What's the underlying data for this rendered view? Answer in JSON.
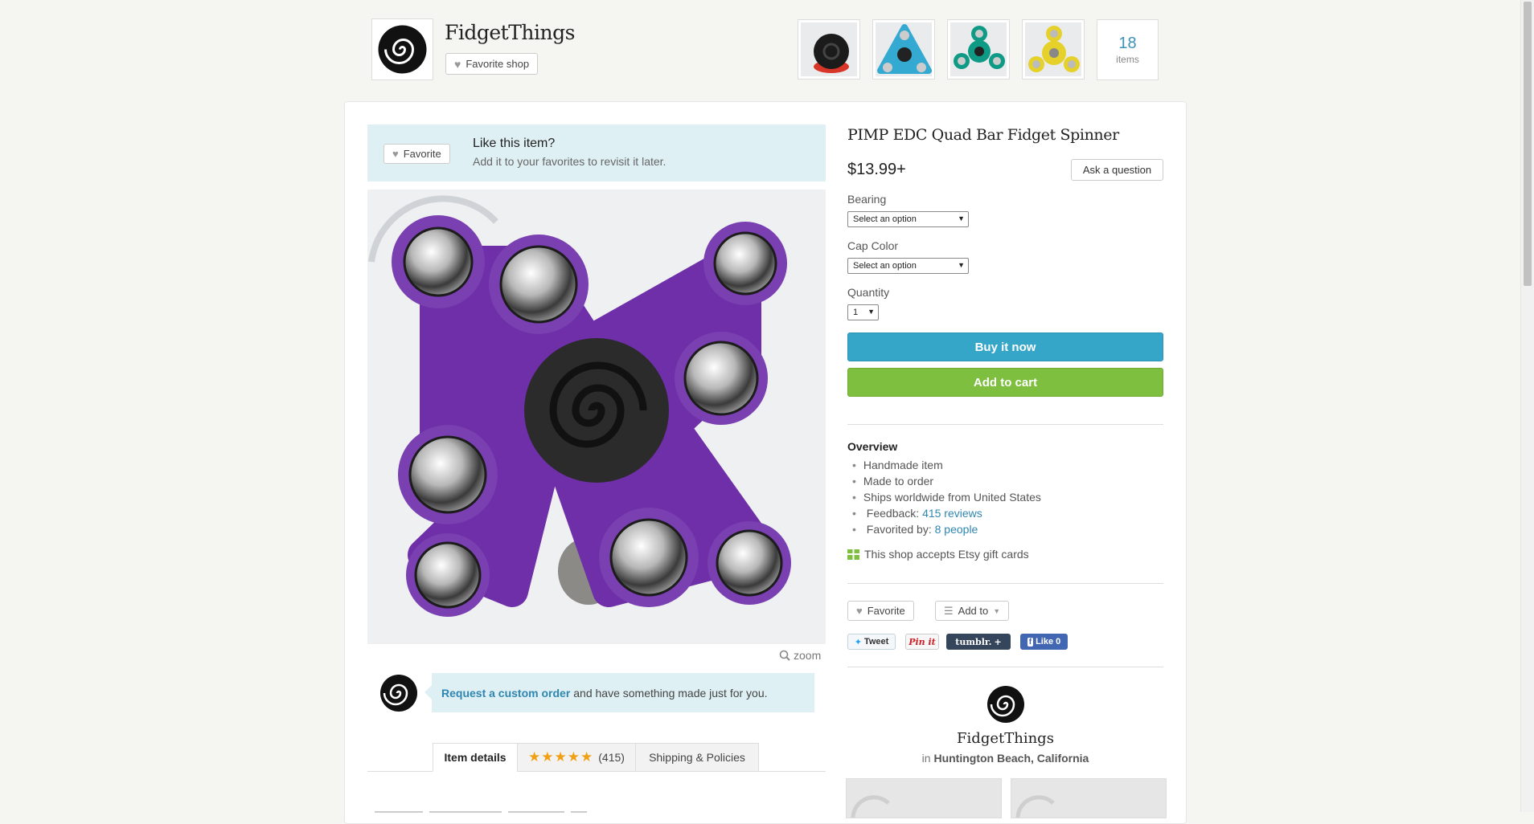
{
  "header": {
    "shop_name": "FidgetThings",
    "favorite_shop_label": "Favorite shop",
    "items_count": "18",
    "items_label": "items"
  },
  "like_banner": {
    "favorite_label": "Favorite",
    "title": "Like this item?",
    "subtitle": "Add it to your favorites to revisit it later."
  },
  "zoom_label": "zoom",
  "custom_order": {
    "link": "Request a custom order",
    "text": "and have something made just for you."
  },
  "tabs": {
    "item_details": "Item details",
    "stars": "★★★★★",
    "reviews_count": "(415)",
    "shipping": "Shipping & Policies"
  },
  "product": {
    "title": "PIMP EDC Quad Bar Fidget Spinner",
    "price": "$13.99+",
    "ask_question": "Ask a question",
    "bearing_label": "Bearing",
    "bearing_value": "Select an option",
    "cap_color_label": "Cap Color",
    "cap_color_value": "Select an option",
    "quantity_label": "Quantity",
    "quantity_value": "1",
    "buy_now": "Buy it now",
    "add_to_cart": "Add to cart"
  },
  "overview": {
    "title": "Overview",
    "handmade": "Handmade item",
    "made_to_order": "Made to order",
    "ships": "Ships worldwide from United States",
    "feedback_label": "Feedback:",
    "feedback_link": "415 reviews",
    "favorited_label": "Favorited by:",
    "favorited_link": "8 people",
    "gift_cards": "This shop accepts Etsy gift cards"
  },
  "actions": {
    "favorite": "Favorite",
    "add_to": "Add to",
    "tweet": "Tweet",
    "pin": "Pin it",
    "tumblr": "tumblr.",
    "like": "Like 0"
  },
  "shop_card": {
    "name": "FidgetThings",
    "in": "in",
    "location": "Huntington Beach, California"
  },
  "colors": {
    "buy": "#35a5c8",
    "cart": "#7ebf3f",
    "spinner": "#7a3fb0",
    "link": "#2f86b1"
  }
}
